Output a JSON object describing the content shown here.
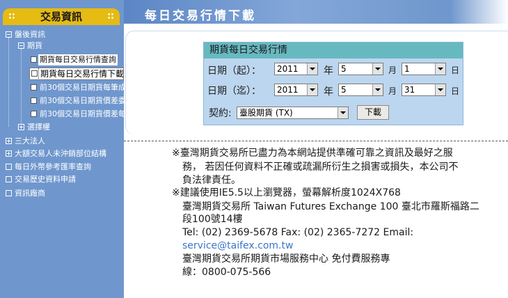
{
  "sidebar": {
    "title": "交易資訊",
    "items": [
      {
        "label": "盤後資訊",
        "type": "expanded"
      },
      {
        "label": "期貨",
        "type": "expanded"
      },
      {
        "label": "期貨每日交易行情查詢",
        "type": "leaf"
      },
      {
        "label": "期貨每日交易行情下載",
        "type": "leaf",
        "selected": true
      },
      {
        "label": "前30個交易日期貨每筆成",
        "type": "leaf"
      },
      {
        "label": "前30個交易日期貨價差委",
        "type": "leaf"
      },
      {
        "label": "前30個交易日期貨價差每",
        "type": "leaf"
      },
      {
        "label": "選擇權",
        "type": "collapsed"
      },
      {
        "label": "三大法人",
        "type": "collapsed"
      },
      {
        "label": "大額交易人未沖銷部位結構",
        "type": "collapsed"
      },
      {
        "label": "每日外幣參考匯率查詢",
        "type": "leaf"
      },
      {
        "label": "交易歷史資料申請",
        "type": "leaf"
      },
      {
        "label": "資訊廠商",
        "type": "leaf"
      }
    ]
  },
  "banner": {
    "title": "每日交易行情下載"
  },
  "form": {
    "title": "期貨每日交易行情",
    "start_label": "日期（起）：",
    "end_label": "日期（迄）：",
    "year_unit": "年",
    "month_unit": "月",
    "day_unit": "日",
    "start_year": "2011",
    "start_month": "5",
    "start_day": "1",
    "end_year": "2011",
    "end_month": "5",
    "end_day": "31",
    "contract_label": "契約:",
    "contract_value": "臺股期貨 (TX)",
    "download_label": "下載"
  },
  "notice": {
    "line1": "※臺灣期貨交易所已盡力為本網站提供準確可靠之資訊及最好之服",
    "line2": "務， 若因任何資料不正確或疏漏所衍生之損害或損失，本公司不",
    "line3": "負法律責任。",
    "line4": "※建議使用IE5.5以上瀏覽器，螢幕解析度1024X768",
    "line5": "臺灣期貨交易所 Taiwan Futures Exchange 100 臺北市羅斯福路二",
    "line6": "段100號14樓",
    "line7": "Tel: (02) 2369-5678 Fax: (02) 2365-7272 Email:",
    "email": "service@taifex.com.tw",
    "line9": "臺灣期貨交易所期貨市場服務中心 免付費服務專",
    "line10": "線：0800-075-566"
  },
  "colors": {
    "sidebar_bg": "#6f97cd",
    "sidebar_header": "#e6bb12",
    "form_bg": "#bcd6ef",
    "form_title_bg": "#67b9c0",
    "link": "#3a76c7"
  }
}
